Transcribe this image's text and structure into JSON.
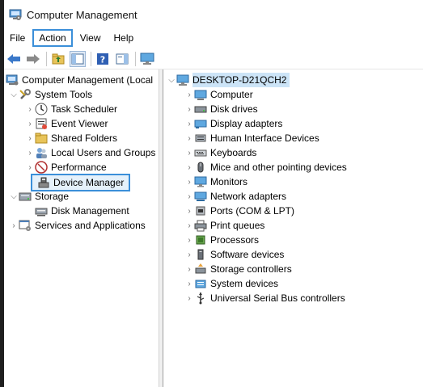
{
  "window": {
    "title": "Computer Management"
  },
  "menu": {
    "file": "File",
    "action": "Action",
    "view": "View",
    "help": "Help"
  },
  "toolbar": {
    "buttons": [
      "back-arrow-icon",
      "forward-arrow-icon",
      "up-folder-icon",
      "show-hide-console-tree-icon",
      "help-icon",
      "action-pane-icon",
      "monitor-icon"
    ]
  },
  "left_tree": {
    "root": "Computer Management (Local",
    "system_tools": "System Tools",
    "task_scheduler": "Task Scheduler",
    "event_viewer": "Event Viewer",
    "shared_folders": "Shared Folders",
    "local_users": "Local Users and Groups",
    "performance": "Performance",
    "device_manager": "Device Manager",
    "storage": "Storage",
    "disk_management": "Disk Management",
    "services_apps": "Services and Applications"
  },
  "device_tree": {
    "root": "DESKTOP-D21QCH2",
    "items": [
      {
        "label": "Computer",
        "icon": "computer-icon"
      },
      {
        "label": "Disk drives",
        "icon": "disk-drive-icon"
      },
      {
        "label": "Display adapters",
        "icon": "display-adapter-icon"
      },
      {
        "label": "Human Interface Devices",
        "icon": "hid-icon"
      },
      {
        "label": "Keyboards",
        "icon": "keyboard-icon"
      },
      {
        "label": "Mice and other pointing devices",
        "icon": "mouse-icon"
      },
      {
        "label": "Monitors",
        "icon": "monitor-icon"
      },
      {
        "label": "Network adapters",
        "icon": "network-adapter-icon"
      },
      {
        "label": "Ports (COM & LPT)",
        "icon": "port-icon"
      },
      {
        "label": "Print queues",
        "icon": "printer-icon"
      },
      {
        "label": "Processors",
        "icon": "processor-icon"
      },
      {
        "label": "Software devices",
        "icon": "software-device-icon"
      },
      {
        "label": "Storage controllers",
        "icon": "storage-controller-icon"
      },
      {
        "label": "System devices",
        "icon": "system-devices-icon"
      },
      {
        "label": "Universal Serial Bus controllers",
        "icon": "usb-icon"
      }
    ]
  },
  "colors": {
    "selection_border": "#3b8fd9",
    "root_highlight": "#cce4f7"
  }
}
